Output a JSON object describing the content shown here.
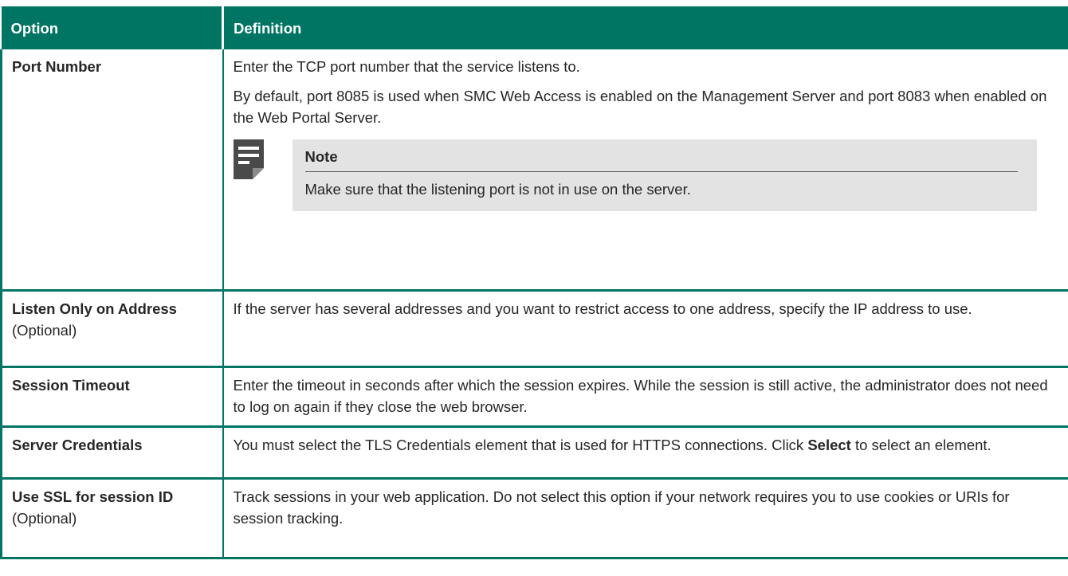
{
  "table": {
    "headers": {
      "option": "Option",
      "definition": "Definition"
    },
    "rows": {
      "port": {
        "name": "Port Number",
        "p1": "Enter the TCP port number that the service listens to.",
        "p2": "By default, port 8085 is used when SMC Web Access is enabled on the Management Server and port 8083 when enabled on the Web Portal Server.",
        "note_title": "Note",
        "note_text": "Make sure that the listening port is not in use on the server.",
        "note_icon": "note-icon"
      },
      "listen": {
        "name": "Listen Only on Address",
        "qualifier": "(Optional)",
        "p1": "If the server has several addresses and you want to restrict access to one address, specify the IP address to use."
      },
      "timeout": {
        "name": "Session Timeout",
        "p1": "Enter the timeout in seconds after which the session expires. While the session is still active, the administrator does not need to log on again if they close the web browser."
      },
      "credentials": {
        "name": "Server Credentials",
        "p1_before": "You must select the TLS Credentials element that is used for HTTPS connections. Click ",
        "p1_bold": "Select",
        "p1_after": " to select an element."
      },
      "ssl": {
        "name": "Use SSL for session ID",
        "qualifier": "(Optional)",
        "p1": "Track sessions in your web application. Do not select this option if your network requires you to use cookies or URIs for session tracking."
      }
    }
  },
  "colors": {
    "header_bg": "#007563",
    "note_bg": "#e3e3e3",
    "icon": "#4a4a4a"
  }
}
